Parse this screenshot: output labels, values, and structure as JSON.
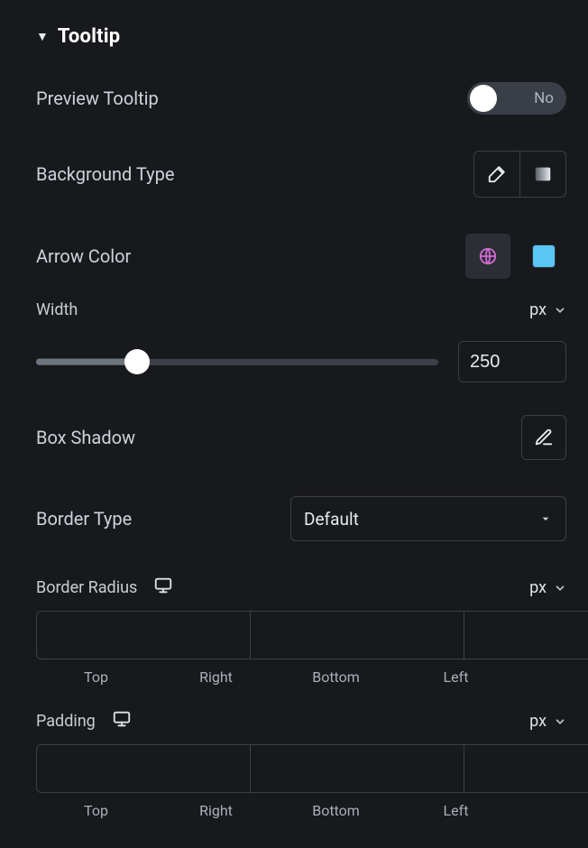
{
  "section": {
    "title": "Tooltip"
  },
  "preview": {
    "label": "Preview Tooltip",
    "state_text": "No",
    "state": false
  },
  "bg_type": {
    "label": "Background Type"
  },
  "arrow_color": {
    "label": "Arrow Color",
    "swatch": "#59c6f3"
  },
  "width": {
    "label": "Width",
    "unit": "px",
    "value": "250",
    "percent": 25
  },
  "box_shadow": {
    "label": "Box Shadow"
  },
  "border_type": {
    "label": "Border Type",
    "value": "Default"
  },
  "border_radius": {
    "label": "Border Radius",
    "unit": "px",
    "sides": [
      "Top",
      "Right",
      "Bottom",
      "Left"
    ]
  },
  "padding": {
    "label": "Padding",
    "unit": "px",
    "sides": [
      "Top",
      "Right",
      "Bottom",
      "Left"
    ]
  }
}
